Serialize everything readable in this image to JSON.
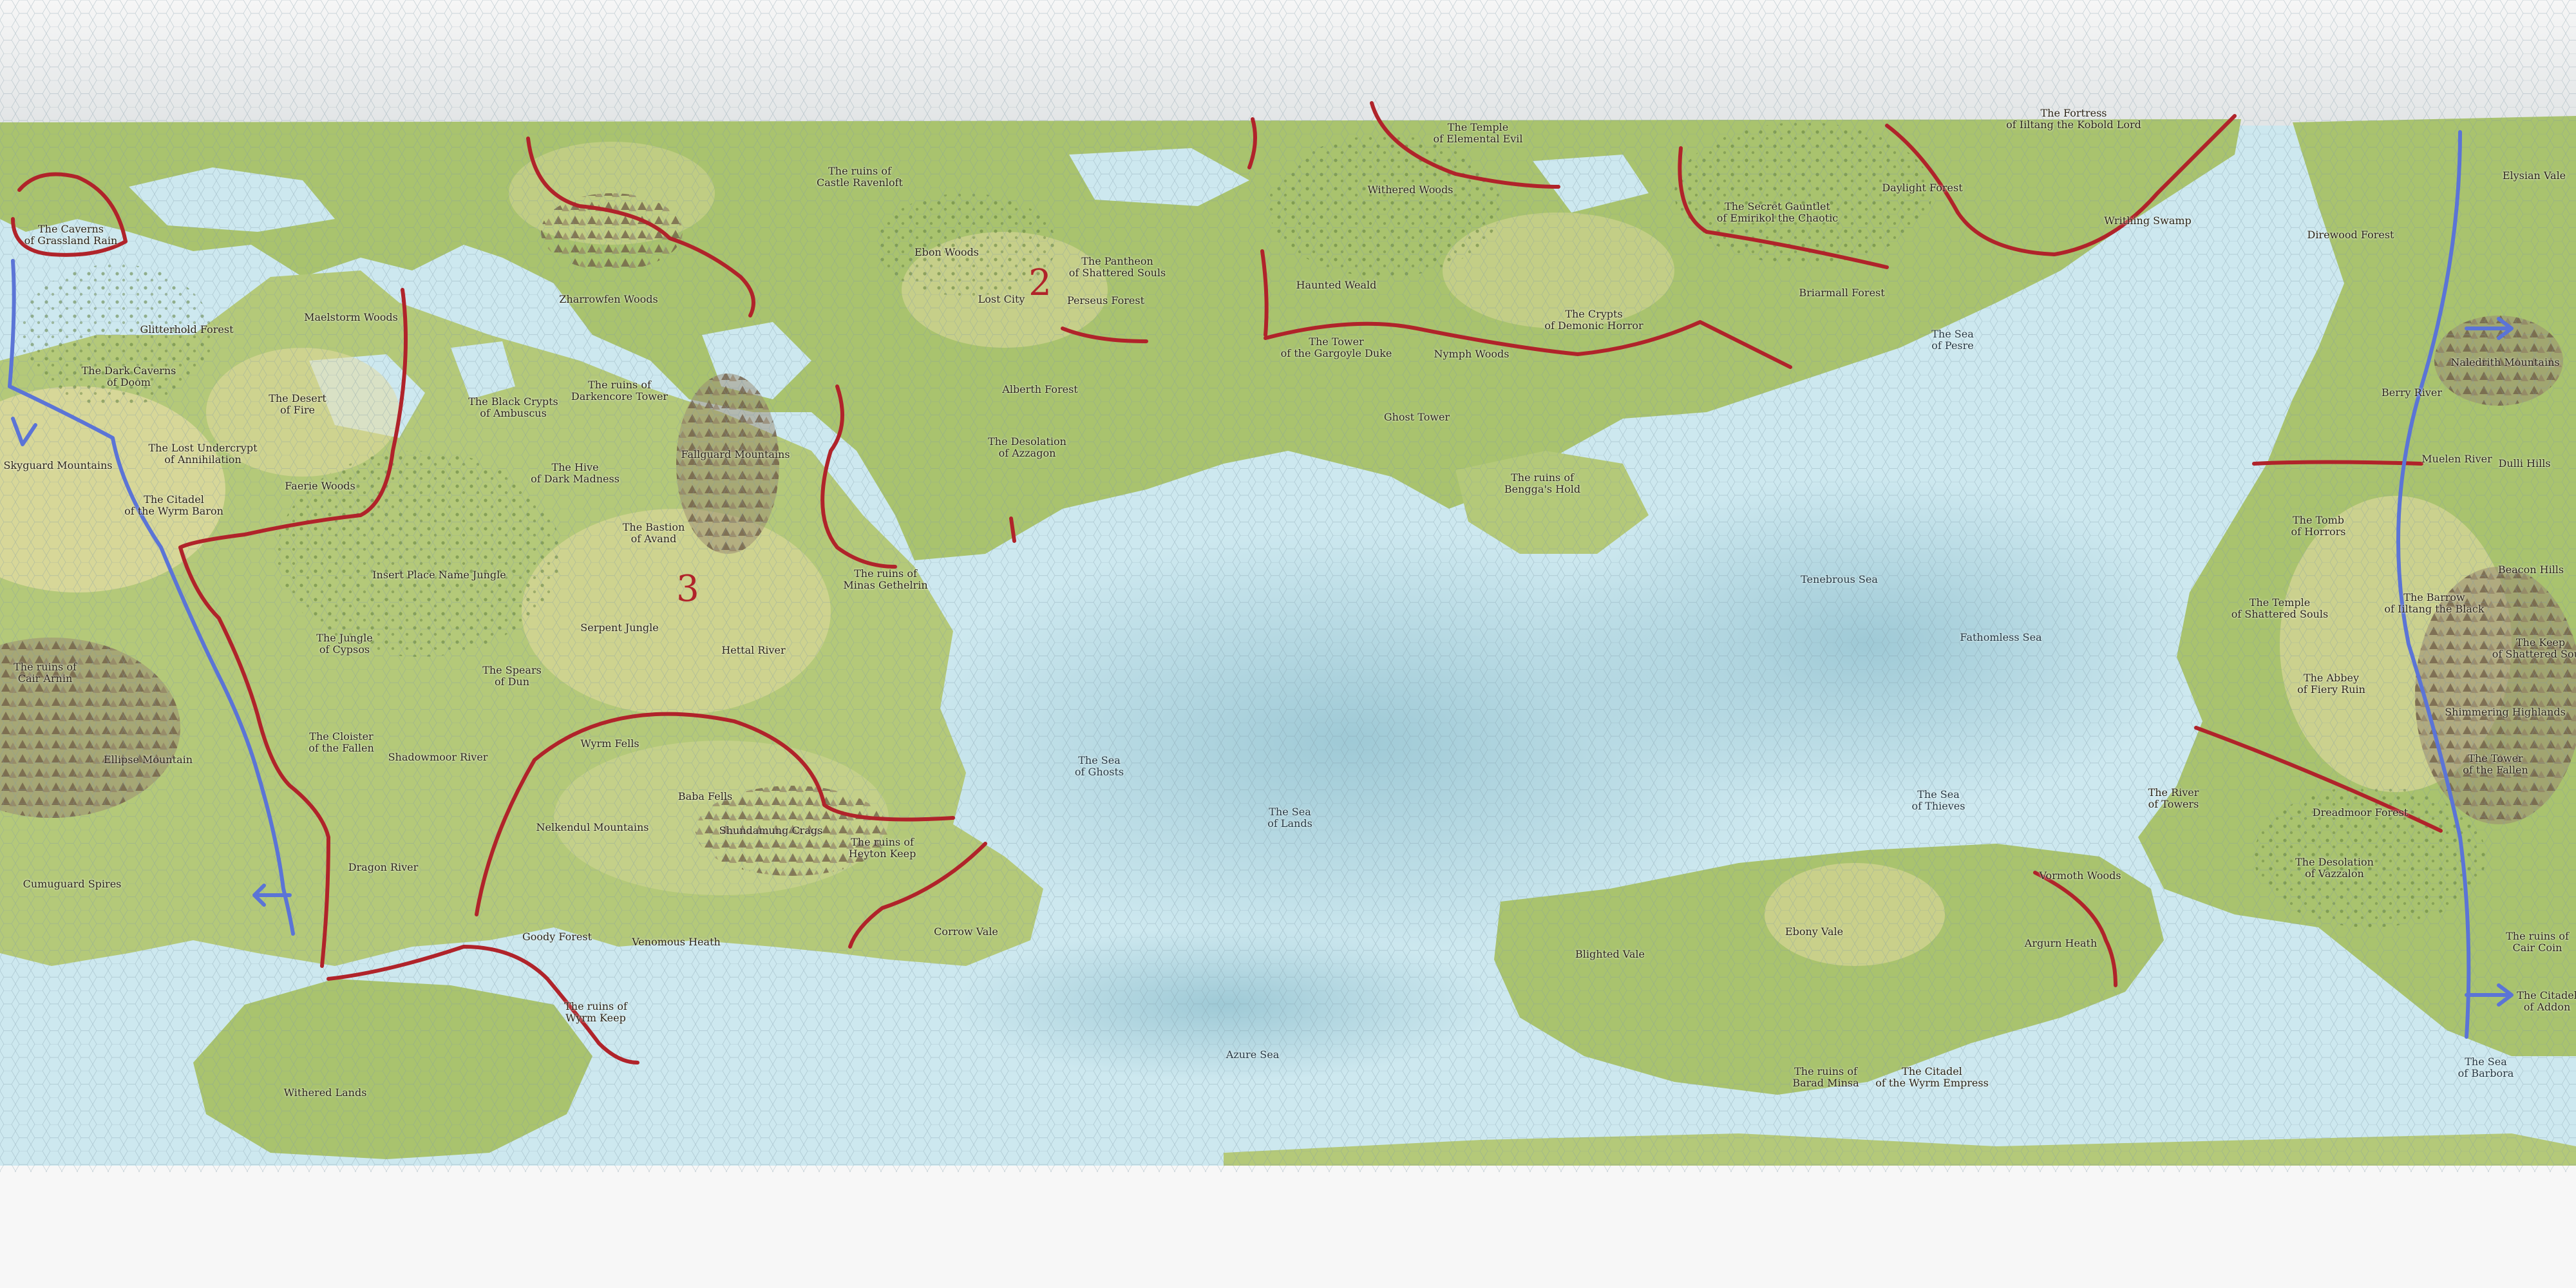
{
  "map": {
    "colors": {
      "background": "#ffffff",
      "ocean": "#cde8ef",
      "deep_ocean": "#a9cdd8",
      "land": "#a9c36e",
      "land_light": "#cfd595",
      "desert": "#e3dba3",
      "mountain": "#9a8a72",
      "ice": "#eceeef",
      "hex_grid": "#7f9aa6",
      "border_red": "#b0232a",
      "route_blue": "#5b74d6"
    },
    "markers": {
      "m2": "2",
      "m3": "3"
    },
    "labels": [
      {
        "id": "caverns-grassland-rain",
        "text": "The Caverns\nof Grassland Rain",
        "type": "place"
      },
      {
        "id": "ruins-castle-ravenloft",
        "text": "The ruins of\nCastle Ravenloft",
        "type": "place"
      },
      {
        "id": "temple-elemental-evil",
        "text": "The Temple\nof Elemental Evil",
        "type": "place"
      },
      {
        "id": "fortress-iiltang",
        "text": "The Fortress\nof Iiltang the Kobold Lord",
        "type": "place"
      },
      {
        "id": "elysian-vale",
        "text": "Elysian Vale",
        "type": "place"
      },
      {
        "id": "withered-woods-n",
        "text": "Withered Woods",
        "type": "place"
      },
      {
        "id": "secret-gauntlet",
        "text": "The Secret Gauntlet\nof Emirikol the Chaotic",
        "type": "place"
      },
      {
        "id": "daylight-forest",
        "text": "Daylight Forest",
        "type": "place"
      },
      {
        "id": "writhing-swamp",
        "text": "Writhing Swamp",
        "type": "place"
      },
      {
        "id": "direwood-forest",
        "text": "Direwood Forest",
        "type": "place"
      },
      {
        "id": "glitterhold-forest",
        "text": "Glitterhold Forest",
        "type": "place"
      },
      {
        "id": "maelstorm-woods",
        "text": "Maelstorm Woods",
        "type": "place"
      },
      {
        "id": "zharrowfen-woods",
        "text": "Zharrowfen Woods",
        "type": "place"
      },
      {
        "id": "ebon-woods",
        "text": "Ebon Woods",
        "type": "place"
      },
      {
        "id": "pantheon-shattered",
        "text": "The Pantheon\nof Shattered Souls",
        "type": "place"
      },
      {
        "id": "lost-city",
        "text": "Lost City",
        "type": "place"
      },
      {
        "id": "perseus-forest",
        "text": "Perseus Forest",
        "type": "place"
      },
      {
        "id": "haunted-weald",
        "text": "Haunted Weald",
        "type": "place"
      },
      {
        "id": "briarmall-forest",
        "text": "Briarmall Forest",
        "type": "place"
      },
      {
        "id": "sea-of-pesre",
        "text": "The Sea\nof Pesre",
        "type": "sea"
      },
      {
        "id": "dark-caverns-doom",
        "text": "The Dark Caverns\nof Doom",
        "type": "place"
      },
      {
        "id": "desert-of-fire",
        "text": "The Desert\nof Fire",
        "type": "place"
      },
      {
        "id": "black-crypts",
        "text": "The Black Crypts\nof Ambuscus",
        "type": "place"
      },
      {
        "id": "ruins-darkencore",
        "text": "The ruins of\nDarkencore Tower",
        "type": "place"
      },
      {
        "id": "tower-gargoyle-duke",
        "text": "The Tower\nof the Gargoyle Duke",
        "type": "place"
      },
      {
        "id": "nymph-woods",
        "text": "Nymph Woods",
        "type": "place"
      },
      {
        "id": "crypts-demonic-horror",
        "text": "The Crypts\nof Demonic Horror",
        "type": "place"
      },
      {
        "id": "alberth-forest",
        "text": "Alberth Forest",
        "type": "place"
      },
      {
        "id": "ghost-tower",
        "text": "Ghost Tower",
        "type": "place"
      },
      {
        "id": "naledrith-mountains",
        "text": "Naledrith Mountains",
        "type": "place"
      },
      {
        "id": "berry-river",
        "text": "Berry River",
        "type": "place"
      },
      {
        "id": "lost-undercrypt",
        "text": "The Lost Undercrypt\nof Annihilation",
        "type": "place"
      },
      {
        "id": "skyguard-mountains",
        "text": "Skyguard Mountains",
        "type": "place"
      },
      {
        "id": "desolation-azzagon",
        "text": "The Desolation\nof Azzagon",
        "type": "place"
      },
      {
        "id": "fallguard-mountains",
        "text": "Fallguard Mountains",
        "type": "place"
      },
      {
        "id": "hive-dark-madness",
        "text": "The Hive\nof Dark Madness",
        "type": "place"
      },
      {
        "id": "ruins-bengga",
        "text": "The ruins of\nBengga's Hold",
        "type": "place"
      },
      {
        "id": "muelen-river",
        "text": "Muelen River",
        "type": "place"
      },
      {
        "id": "dulli-hills",
        "text": "Dulli Hills",
        "type": "place"
      },
      {
        "id": "citadel-wyrm-baron",
        "text": "The Citadel\nof the Wyrm Baron",
        "type": "place"
      },
      {
        "id": "faerie-woods",
        "text": "Faerie Woods",
        "type": "place"
      },
      {
        "id": "bastion-avand",
        "text": "The Bastion\nof Avand",
        "type": "place"
      },
      {
        "id": "tomb-of-horrors",
        "text": "The Tomb\nof Horrors",
        "type": "place"
      },
      {
        "id": "insert-place-name-jungle",
        "text": "Insert Place Name Jungle",
        "type": "place"
      },
      {
        "id": "ruins-minas-gethelrin",
        "text": "The ruins of\nMinas Gethelrin",
        "type": "place"
      },
      {
        "id": "tenebrous-sea",
        "text": "Tenebrous Sea",
        "type": "sea"
      },
      {
        "id": "beacon-hills",
        "text": "Beacon Hills",
        "type": "place"
      },
      {
        "id": "temple-shattered-souls",
        "text": "The Temple\nof Shattered Souls",
        "type": "place"
      },
      {
        "id": "barrow-iiltang",
        "text": "The Barrow\nof Iiltang the Black",
        "type": "place"
      },
      {
        "id": "jungle-cypsos",
        "text": "The Jungle\nof Cypsos",
        "type": "place"
      },
      {
        "id": "serpent-jungle",
        "text": "Serpent Jungle",
        "type": "place"
      },
      {
        "id": "hettal-river",
        "text": "Hettal River",
        "type": "place"
      },
      {
        "id": "fathomless-sea",
        "text": "Fathomless Sea",
        "type": "sea"
      },
      {
        "id": "keep-shattered-souls",
        "text": "The Keep\nof Shattered Souls",
        "type": "place"
      },
      {
        "id": "ruins-cair-arnin",
        "text": "The ruins of\nCair Arnin",
        "type": "place"
      },
      {
        "id": "spears-dun",
        "text": "The Spears\nof Dun",
        "type": "place"
      },
      {
        "id": "abbey-fiery-ruin",
        "text": "The Abbey\nof Fiery Ruin",
        "type": "place"
      },
      {
        "id": "shimmering-highlands",
        "text": "Shimmering Highlands",
        "type": "place"
      },
      {
        "id": "cloister-fallen",
        "text": "The Cloister\nof the Fallen",
        "type": "place"
      },
      {
        "id": "shadowmoor-river",
        "text": "Shadowmoor River",
        "type": "place"
      },
      {
        "id": "wyrm-fells",
        "text": "Wyrm Fells",
        "type": "place"
      },
      {
        "id": "ellipse-mountain",
        "text": "Ellipse Mountain",
        "type": "place"
      },
      {
        "id": "sea-of-ghosts",
        "text": "The Sea\nof Ghosts",
        "type": "sea"
      },
      {
        "id": "tower-fallen",
        "text": "The Tower\nof the Fallen",
        "type": "place"
      },
      {
        "id": "baba-fells",
        "text": "Baba Fells",
        "type": "place"
      },
      {
        "id": "sea-of-lands",
        "text": "The Sea\nof Lands",
        "type": "sea"
      },
      {
        "id": "sea-of-thieves",
        "text": "The Sea\nof Thieves",
        "type": "sea"
      },
      {
        "id": "river-of-towers",
        "text": "The River\nof Towers",
        "type": "place"
      },
      {
        "id": "dreadmoor-forest",
        "text": "Dreadmoor Forest",
        "type": "place"
      },
      {
        "id": "nelkendul-mountains",
        "text": "Nelkendul Mountains",
        "type": "place"
      },
      {
        "id": "shundamung-crags",
        "text": "Shundamung Crags",
        "type": "place"
      },
      {
        "id": "ruins-heyton-keep",
        "text": "The ruins of\nHeyton Keep",
        "type": "place"
      },
      {
        "id": "dragon-river",
        "text": "Dragon River",
        "type": "place"
      },
      {
        "id": "desolation-vazzalon",
        "text": "The Desolation\nof Vazzalon",
        "type": "place"
      },
      {
        "id": "vormoth-woods",
        "text": "Vormoth Woods",
        "type": "place"
      },
      {
        "id": "cumuguard-spires",
        "text": "Cumuguard Spires",
        "type": "place"
      },
      {
        "id": "corrow-vale",
        "text": "Corrow Vale",
        "type": "place"
      },
      {
        "id": "ebony-vale",
        "text": "Ebony Vale",
        "type": "place"
      },
      {
        "id": "goody-forest",
        "text": "Goody Forest",
        "type": "place"
      },
      {
        "id": "venomous-heath",
        "text": "Venomous Heath",
        "type": "place"
      },
      {
        "id": "blighted-vale",
        "text": "Blighted Vale",
        "type": "place"
      },
      {
        "id": "argurn-heath",
        "text": "Argurn Heath",
        "type": "place"
      },
      {
        "id": "ruins-cair-coin",
        "text": "The ruins of\nCair Coin",
        "type": "place"
      },
      {
        "id": "citadel-addon",
        "text": "The Citadel\nof Addon",
        "type": "place"
      },
      {
        "id": "ruins-wyrm-keep",
        "text": "The ruins of\nWyrm Keep",
        "type": "place"
      },
      {
        "id": "azure-sea",
        "text": "Azure Sea",
        "type": "sea"
      },
      {
        "id": "sea-of-barbora",
        "text": "The Sea\nof Barbora",
        "type": "sea"
      },
      {
        "id": "ruins-barad-minsa",
        "text": "The ruins of\nBarad Minsa",
        "type": "place"
      },
      {
        "id": "citadel-wyrm-empress",
        "text": "The Citadel\nof the Wyrm Empress",
        "type": "place"
      },
      {
        "id": "withered-lands",
        "text": "Withered Lands",
        "type": "place"
      }
    ]
  }
}
